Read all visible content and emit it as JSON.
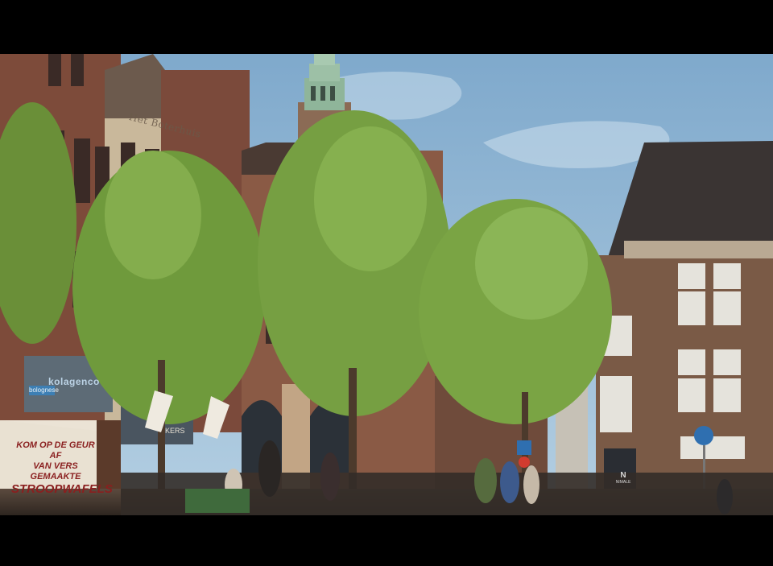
{
  "image": {
    "description_colors": {
      "sky": "#8fb8d8",
      "brick": "#8a5a45",
      "tree": "#6f9a3c",
      "tower_roof": "#8fb59a"
    }
  },
  "signage": {
    "stroopwafel_banner": {
      "line1": "KOM OP DE GEUR AF",
      "line2": "VAN VERS GEMAAKTE",
      "line3": "STROOPWAFELS"
    },
    "facade_lettering": "Het Boterhuis",
    "blue_shop_sign": "bolognese",
    "shop_name": "kolagenco",
    "kers_sign": "KERS",
    "right_shop": {
      "logo": "N",
      "name": "NIMALE"
    }
  }
}
